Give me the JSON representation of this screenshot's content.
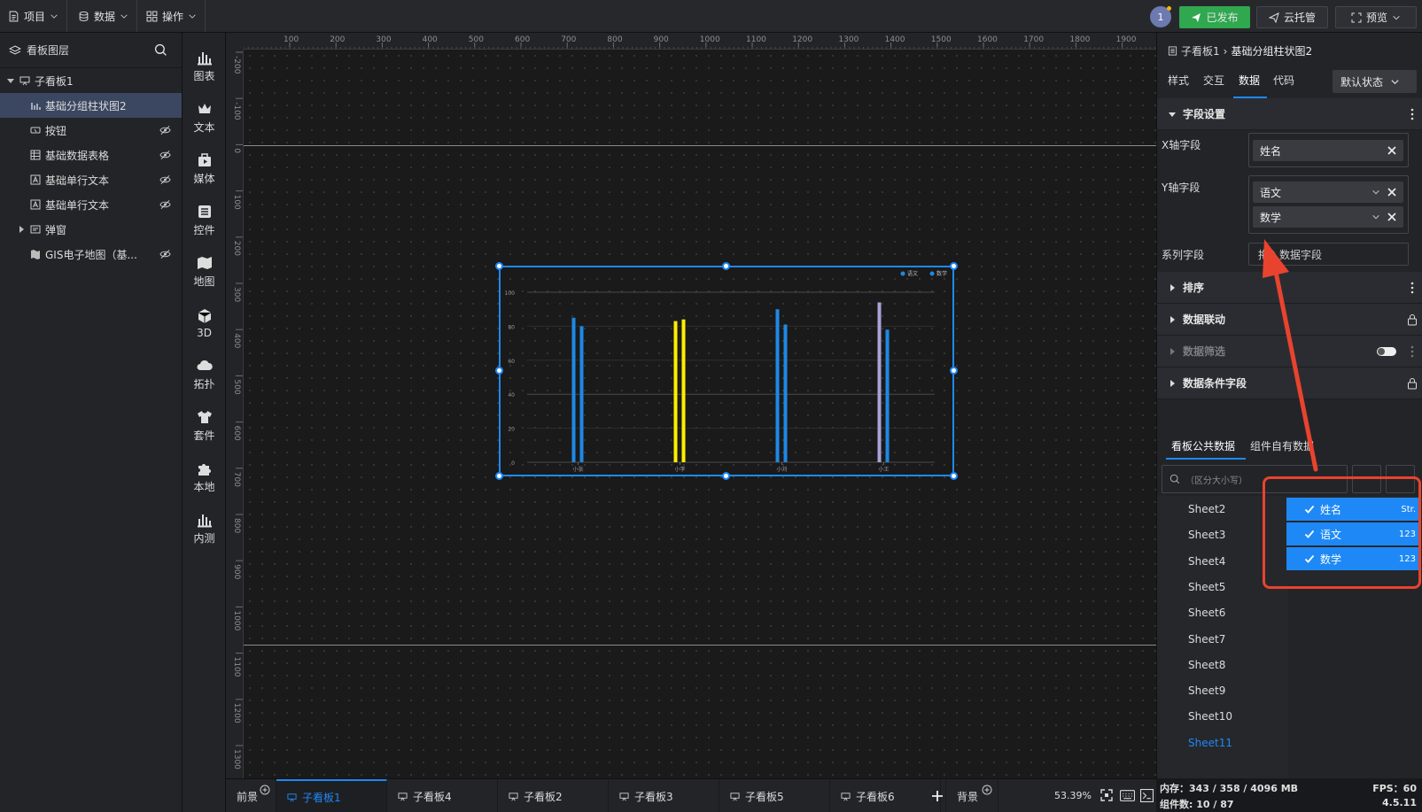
{
  "topbar": {
    "menus": [
      {
        "label": "项目"
      },
      {
        "label": "数据"
      },
      {
        "label": "操作"
      }
    ],
    "badge": "1",
    "published": "已发布",
    "cloud": "云托管",
    "preview": "预览"
  },
  "layers": {
    "title": "看板图层",
    "items": [
      {
        "label": "子看板1"
      },
      {
        "label": "基础分组柱状图2"
      },
      {
        "label": "按钮"
      },
      {
        "label": "基础数据表格"
      },
      {
        "label": "基础单行文本"
      },
      {
        "label": "基础单行文本"
      },
      {
        "label": "弹窗"
      },
      {
        "label": "GIS电子地图（基..."
      }
    ]
  },
  "tools": [
    {
      "label": "图表",
      "icon": "bar-chart-icon"
    },
    {
      "label": "文本",
      "icon": "crown-icon"
    },
    {
      "label": "媒体",
      "icon": "media-icon"
    },
    {
      "label": "控件",
      "icon": "widget-icon"
    },
    {
      "label": "地图",
      "icon": "map-icon"
    },
    {
      "label": "3D",
      "icon": "cube-icon"
    },
    {
      "label": "拓扑",
      "icon": "cloud-icon"
    },
    {
      "label": "套件",
      "icon": "shirt-icon"
    },
    {
      "label": "本地",
      "icon": "puzzle-icon"
    },
    {
      "label": "内测",
      "icon": "bar-chart-icon"
    }
  ],
  "rulers": {
    "top": [
      "100",
      "200",
      "300",
      "400",
      "500",
      "600",
      "700",
      "800",
      "900",
      "1000",
      "1100",
      "1200",
      "1300",
      "1400",
      "1500",
      "1600",
      "1700",
      "1800",
      "1900"
    ],
    "left": [
      "-200",
      "-100",
      "0",
      "100",
      "200",
      "300",
      "400",
      "500",
      "600",
      "700",
      "800",
      "900",
      "1000",
      "1100",
      "1200",
      "1300"
    ]
  },
  "chart_data": {
    "type": "bar",
    "categories": [
      "小张",
      "小李",
      "小刘",
      "小王"
    ],
    "series": [
      {
        "name": "语文",
        "values": [
          85,
          83,
          90,
          94
        ]
      },
      {
        "name": "数学",
        "values": [
          80,
          84,
          81,
          78
        ]
      }
    ],
    "bar_colors": [
      [
        "#1e88e5",
        "#1e88e5"
      ],
      [
        "#ffee00",
        "#ffee00"
      ],
      [
        "#1e88e5",
        "#1e88e5"
      ],
      [
        "#a9a3d8",
        "#1e88e5"
      ]
    ],
    "y_ticks": [
      "0",
      "20",
      "40",
      "60",
      "80",
      "100"
    ],
    "ylim": [
      0,
      100
    ],
    "legend_position": "top-right"
  },
  "right": {
    "breadcrumb": {
      "root": "子看板1",
      "sep": "›",
      "current": "基础分组柱状图2"
    },
    "tabs": [
      {
        "label": "样式"
      },
      {
        "label": "交互"
      },
      {
        "label": "数据"
      },
      {
        "label": "代码"
      }
    ],
    "state": "默认状态",
    "field_section": "字段设置",
    "x_label": "X轴字段",
    "x_fields": [
      "姓名"
    ],
    "y_label": "Y轴字段",
    "y_fields": [
      "语文",
      "数学"
    ],
    "series_label": "系列字段",
    "series_placeholder": "拖入数据字段",
    "sections": [
      {
        "label": "排序"
      },
      {
        "label": "数据联动"
      },
      {
        "label": "数据筛选"
      },
      {
        "label": "数据条件字段"
      }
    ],
    "data_tabs": [
      {
        "label": "看板公共数据"
      },
      {
        "label": "组件自有数据"
      }
    ],
    "search_placeholder": "（区分大小写）",
    "sheets": [
      "Sheet2",
      "Sheet3",
      "Sheet4",
      "Sheet5",
      "Sheet6",
      "Sheet7",
      "Sheet8",
      "Sheet9",
      "Sheet10",
      "Sheet11"
    ],
    "fields": [
      {
        "name": "姓名",
        "type": "Str."
      },
      {
        "name": "语文",
        "type": "123"
      },
      {
        "name": "数学",
        "type": "123"
      }
    ],
    "accent": "#1e89f6",
    "highlight": "#e8432e"
  },
  "bottom": {
    "front": "前景",
    "tabs": [
      {
        "label": "子看板1"
      },
      {
        "label": "子看板4"
      },
      {
        "label": "子看板2"
      },
      {
        "label": "子看板3"
      },
      {
        "label": "子看板5"
      },
      {
        "label": "子看板6"
      }
    ],
    "back": "背景",
    "zoom": "53.39%"
  },
  "status": {
    "memory": "内存：343 / 358 / 4096 MB",
    "fps": "FPS：60",
    "count": "组件数: 10 / 87",
    "version": "4.5.11"
  }
}
